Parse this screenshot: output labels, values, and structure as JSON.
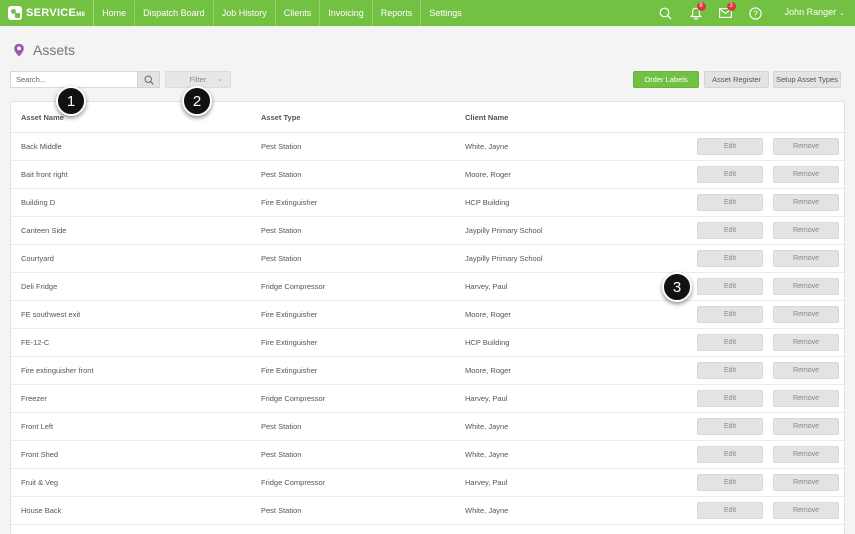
{
  "brand": {
    "name": "SERVICE",
    "suffix": "M8"
  },
  "nav": {
    "items": [
      {
        "label": "Home"
      },
      {
        "label": "Dispatch Board"
      },
      {
        "label": "Job History"
      },
      {
        "label": "Clients"
      },
      {
        "label": "Invoicing"
      },
      {
        "label": "Reports"
      },
      {
        "label": "Settings"
      }
    ],
    "notifications_count": "8",
    "messages_count": "3",
    "user_name": "John Ranger"
  },
  "page": {
    "title": "Assets",
    "icon": "map-pin-icon"
  },
  "toolbar": {
    "search_placeholder": "Search...",
    "filter_label": "Filter",
    "order_labels": "Order Labels",
    "asset_register": "Asset Register",
    "setup_asset_types": "Setup Asset Types"
  },
  "table": {
    "columns": [
      "Asset Name",
      "Asset Type",
      "Client Name"
    ],
    "edit_label": "Edit",
    "remove_label": "Remove",
    "rows": [
      {
        "name": "Back Middle",
        "type": "Pest Station",
        "client": "White, Jayne"
      },
      {
        "name": "Bait front right",
        "type": "Pest Station",
        "client": "Moore, Roger"
      },
      {
        "name": "Building D",
        "type": "Fire Extinguisher",
        "client": "HCP Building"
      },
      {
        "name": "Canteen Side",
        "type": "Pest Station",
        "client": "Jaypilly Primary School"
      },
      {
        "name": "Courtyard",
        "type": "Pest Station",
        "client": "Jaypilly Primary School"
      },
      {
        "name": "Deli Fridge",
        "type": "Fridge Compressor",
        "client": "Harvey, Paul"
      },
      {
        "name": "FE southwest exit",
        "type": "Fire Extinguisher",
        "client": "Moore, Roger"
      },
      {
        "name": "FE-12-C",
        "type": "Fire Extinguisher",
        "client": "HCP Building"
      },
      {
        "name": "Fire extinguisher front",
        "type": "Fire Extinguisher",
        "client": "Moore, Roger"
      },
      {
        "name": "Freezer",
        "type": "Fridge Compressor",
        "client": "Harvey, Paul"
      },
      {
        "name": "Front Left",
        "type": "Pest Station",
        "client": "White, Jayne"
      },
      {
        "name": "Front Shed",
        "type": "Pest Station",
        "client": "White, Jayne"
      },
      {
        "name": "Fruit & Veg",
        "type": "Fridge Compressor",
        "client": "Harvey, Paul"
      },
      {
        "name": "House Back",
        "type": "Pest Station",
        "client": "White, Jayne"
      }
    ]
  },
  "callouts": [
    "1",
    "2",
    "3"
  ]
}
